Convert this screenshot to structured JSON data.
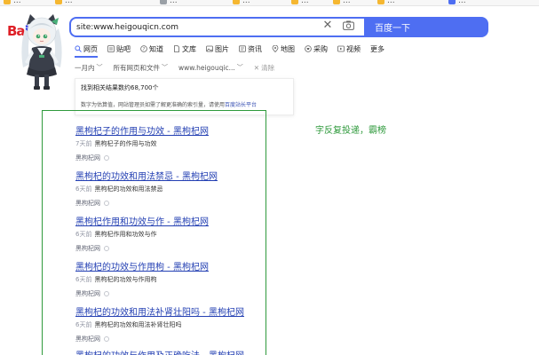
{
  "bookmarks": [
    {
      "label": "...",
      "icon": "folder-icon"
    },
    {
      "label": "...",
      "icon": "folder-icon"
    },
    {
      "label": "...",
      "icon": "page-icon"
    },
    {
      "label": "...",
      "icon": "folder-icon"
    },
    {
      "label": "...",
      "icon": "folder-icon"
    },
    {
      "label": "...",
      "icon": "folder-icon"
    },
    {
      "label": "...",
      "icon": "folder-icon"
    },
    {
      "label": "...",
      "icon": "page-icon"
    }
  ],
  "search": {
    "query": "site:www.heigouqicn.com",
    "button_label": "百度一下",
    "clear_icon": "close-icon",
    "camera_icon": "camera-icon"
  },
  "tabs": [
    {
      "label": "网页",
      "icon": "search-icon",
      "active": true
    },
    {
      "label": "贴吧",
      "icon": "tieba-icon"
    },
    {
      "label": "知道",
      "icon": "question-icon"
    },
    {
      "label": "文库",
      "icon": "document-icon"
    },
    {
      "label": "图片",
      "icon": "image-icon"
    },
    {
      "label": "资讯",
      "icon": "news-icon"
    },
    {
      "label": "地图",
      "icon": "map-icon"
    },
    {
      "label": "采购",
      "icon": "cart-icon"
    },
    {
      "label": "视频",
      "icon": "video-icon"
    },
    {
      "label": "更多",
      "icon": ""
    }
  ],
  "filters": {
    "time": "一月内",
    "filetype": "所有网页和文件",
    "site": "www.heigouqic...",
    "clear": "清除"
  },
  "info": {
    "count_text": "找到相关结果数约68,700个",
    "tip_prefix": "数字为估算值，网站管理员如需了解更准确的索引量，请使用",
    "tip_link": "百度站长平台"
  },
  "annotation": "字反复投递，霸榜",
  "results": [
    {
      "title": "黑枸杞子的作用与功效 - 黑枸杞网",
      "age": "7天前",
      "snippet": "黑枸杞子的作用与功效",
      "source": "黑枸杞网"
    },
    {
      "title": "黑枸杞的功效和用法禁忌 - 黑枸杞网",
      "age": "6天前",
      "snippet": "黑枸杞的功效和用法禁忌",
      "source": "黑枸杞网"
    },
    {
      "title": "黑枸杞作用和功效与作 - 黑枸杞网",
      "age": "6天前",
      "snippet": "黑枸杞作用和功效与作",
      "source": "黑枸杞网"
    },
    {
      "title": "黑枸杞的功效与作用枸 - 黑枸杞网",
      "age": "6天前",
      "snippet": "黑枸杞的功效与作用枸",
      "source": "黑枸杞网"
    },
    {
      "title": "黑枸杞的功效和用法补肾壮阳吗 - 黑枸杞网",
      "age": "6天前",
      "snippet": "黑枸杞的功效和用法补肾壮阳吗",
      "source": "黑枸杞网"
    },
    {
      "title": "黑枸杞的功效与作用及正确吃法 - 黑枸杞网",
      "age": "",
      "snippet": "",
      "source": ""
    }
  ],
  "colors": {
    "brand_blue": "#4e6ef2",
    "link_blue": "#2440b3",
    "annotation_green": "#2f9a3c"
  }
}
